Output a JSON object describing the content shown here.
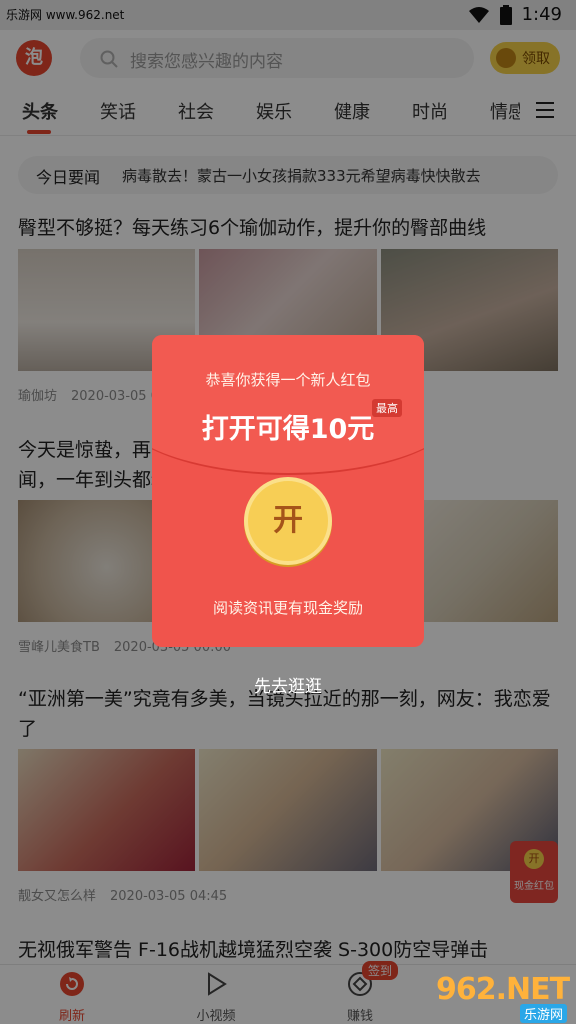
{
  "status_bar": {
    "watermark": "乐游网 www.962.net",
    "time": "1:49"
  },
  "header": {
    "logo_text": "泡",
    "search_placeholder": "搜索您感兴趣的内容",
    "claim_label": "领取"
  },
  "tabs": [
    {
      "label": "头条",
      "active": true
    },
    {
      "label": "笑话"
    },
    {
      "label": "社会"
    },
    {
      "label": "娱乐"
    },
    {
      "label": "健康"
    },
    {
      "label": "时尚"
    },
    {
      "label": "情感"
    }
  ],
  "news_bar": {
    "label": "今日要闻",
    "text": "病毒散去！蒙古一小女孩捐款333元希望病毒快快散去"
  },
  "articles": [
    {
      "title": "臀型不够挺？每天练习6个瑜伽动作，提升你的臀部曲线",
      "source": "瑜伽坊",
      "time": "2020-03-05 0"
    },
    {
      "title": "今天是惊蛰，再                                                              闻，一年到头都精神",
      "source": "雪峰儿美食TB",
      "time": "2020-03-05 00:00"
    },
    {
      "title": "“亚洲第一美”究竟有多美，当镜头拉近的那一刻，网友：我恋爱了",
      "source": "靓女又怎么样",
      "time": "2020-03-05 04:45"
    },
    {
      "title": "无视俄军警告 F-16战机越境猛烈空袭 S-300防空导弹击"
    }
  ],
  "float_packet": {
    "coin": "开",
    "label": "现金红包"
  },
  "bottom_nav": [
    {
      "label": "刷新",
      "icon": "refresh-icon",
      "active": true
    },
    {
      "label": "小视频",
      "icon": "play-icon"
    },
    {
      "label": "赚钱",
      "icon": "diamond-icon",
      "badge": "签到"
    }
  ],
  "modal": {
    "subtitle": "恭喜你获得一个新人红包",
    "main": "打开可得10元",
    "badge": "最高",
    "open_label": "开",
    "footer": "阅读资讯更有现金奖励",
    "browse_label": "先去逛逛"
  },
  "site_watermark": {
    "main": "962.NET",
    "sub": "乐游网"
  },
  "colors": {
    "accent": "#e8452f",
    "packet_red": "#f0544c",
    "gold": "#f7ce55"
  }
}
